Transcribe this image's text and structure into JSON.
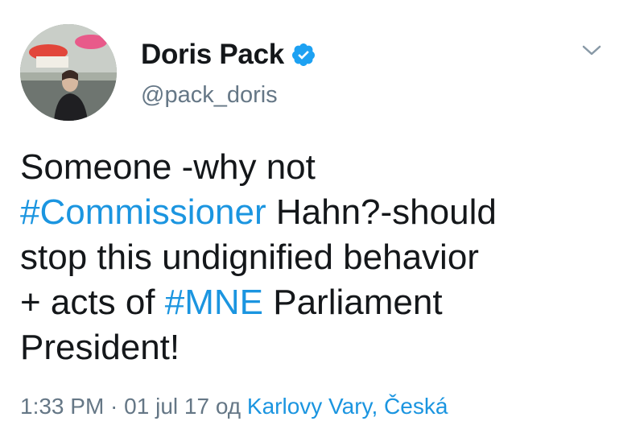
{
  "tweet": {
    "author": {
      "display_name": "Doris Pack",
      "handle": "@pack_doris",
      "verified": true,
      "avatar_icon": "profile-photo"
    },
    "menu_icon": "chevron-down-icon",
    "text_lines": [
      [
        {
          "text": "Someone -why not",
          "type": "text"
        }
      ],
      [
        {
          "text": "#Commissioner",
          "type": "hashtag"
        },
        {
          "text": " Hahn?-should",
          "type": "text"
        }
      ],
      [
        {
          "text": "stop this undignified behavior",
          "type": "text"
        }
      ],
      [
        {
          "text": "+ acts of ",
          "type": "text"
        },
        {
          "text": "#MNE",
          "type": "hashtag"
        },
        {
          "text": " Parliament",
          "type": "text"
        }
      ],
      [
        {
          "text": "President!",
          "type": "text"
        }
      ]
    ],
    "meta": {
      "time": "1:33 PM",
      "separator": " · ",
      "date": "01 jul 17",
      "source_prefix": " од ",
      "location": "Karlovy Vary, Česká"
    }
  },
  "colors": {
    "text": "#14171a",
    "secondary": "#657786",
    "link": "#1b95e0",
    "verified": "#1da1f2"
  }
}
